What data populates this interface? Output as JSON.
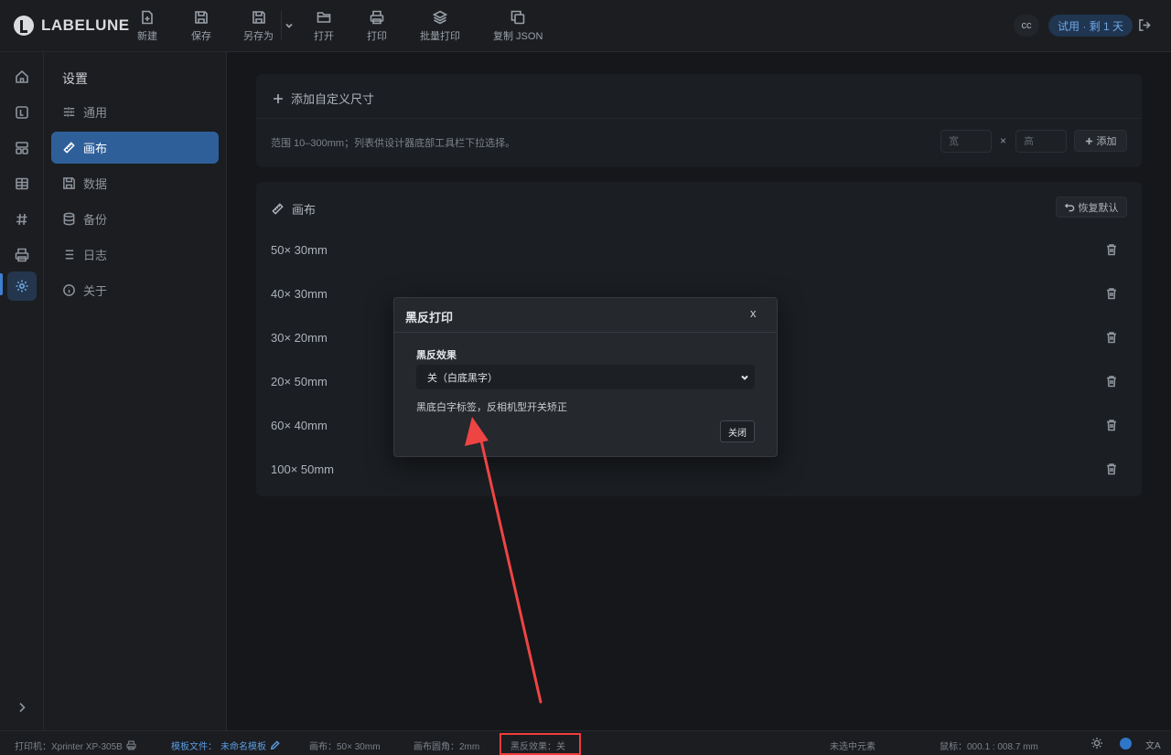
{
  "app": {
    "logo_text": "LABELUNE"
  },
  "toolbar": {
    "new": "新建",
    "save": "保存",
    "save_as": "另存为",
    "open": "打开",
    "print": "打印",
    "batch_print": "批量打印",
    "copy_json": "复制 JSON"
  },
  "header": {
    "user": "cc",
    "trial": "试用 · 剩 1 天"
  },
  "sidebar": {
    "title": "设置",
    "items": [
      {
        "label": "通用",
        "icon": "sliders-icon"
      },
      {
        "label": "画布",
        "icon": "ruler-icon",
        "active": true
      },
      {
        "label": "数据",
        "icon": "save-icon"
      },
      {
        "label": "备份",
        "icon": "database-icon"
      },
      {
        "label": "日志",
        "icon": "list-icon"
      },
      {
        "label": "关于",
        "icon": "info-icon"
      }
    ]
  },
  "add_size": {
    "title": "添加自定义尺寸",
    "hint": "范围 10–300mm；列表供设计器底部工具栏下拉选择。",
    "width_placeholder": "宽",
    "height_placeholder": "高",
    "times": "×",
    "add_button": "添加"
  },
  "canvas_section": {
    "title": "画布",
    "reset_button": "恢复默认",
    "sizes": [
      "50× 30mm",
      "40× 30mm",
      "30× 20mm",
      "20× 50mm",
      "60× 40mm",
      "100× 50mm"
    ]
  },
  "modal": {
    "title": "黑反打印",
    "close": "x",
    "field_label": "黑反效果",
    "select_value": "关（白底黑字）",
    "note": "黑底白字标签，反相机型开关矫正",
    "close_button": "关闭"
  },
  "status": {
    "printer": "打印机：Xprinter XP-305B",
    "template_label": "模板文件：",
    "template_name": "未命名模板",
    "canvas": "画布：50× 30mm",
    "corner": "画布圆角：2mm",
    "inverse": "黑反效果：关",
    "selection": "未选中元素",
    "cursor": "鼠标：000.1 : 008.7 mm",
    "lang": "文A"
  },
  "colors": {
    "accent": "#2f5f99",
    "annotation": "#ef3b3b",
    "link": "#5b9be0"
  }
}
